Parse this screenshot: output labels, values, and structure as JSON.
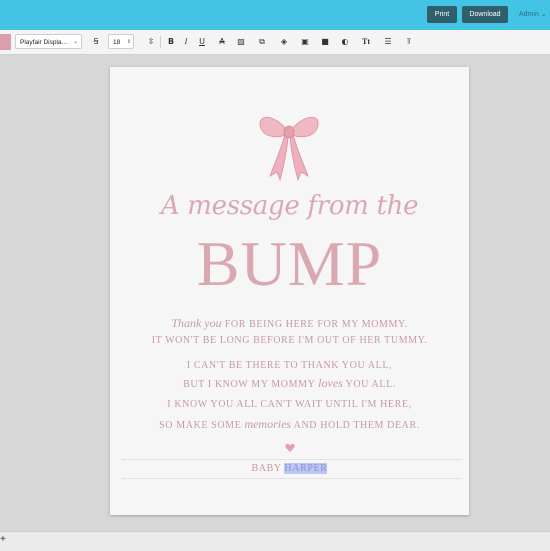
{
  "header": {
    "print_label": "Print",
    "download_label": "Download",
    "admin_label": "Admin"
  },
  "toolbar": {
    "font_family": "Playfair Displa…",
    "font_size": "18",
    "icons": [
      "font-clear-icon",
      "line-height-icon",
      "bold-icon",
      "italic-icon",
      "underline-icon",
      "strikethrough-icon",
      "image-icon",
      "copy-icon",
      "layers-icon",
      "lock-icon",
      "group-icon",
      "color-icon",
      "text-case-icon",
      "line-spacing-icon",
      "align-icon"
    ]
  },
  "card": {
    "title_script": "A message from the",
    "title_main": "BUMP",
    "line1_italic": "Thank you",
    "line1_rest": " FOR BEING HERE FOR MY MOMMY.",
    "line2": "IT WON'T BE LONG BEFORE I'M OUT OF HER TUMMY.",
    "line3": "I CAN'T BE THERE TO THANK YOU ALL,",
    "line4_a": "BUT I KNOW MY MOMMY ",
    "line4_italic": "loves",
    "line4_b": " YOU ALL.",
    "line5": "I KNOW YOU ALL CAN'T WAIT UNTIL I'M HERE,",
    "line6_a": "SO MAKE SOME ",
    "line6_italic": "memories",
    "line6_b": " AND HOLD THEM DEAR.",
    "name_prefix": "BABY ",
    "name_selected": "HARPER"
  },
  "bottom_bar": {
    "add_label": "+"
  },
  "colors": {
    "accent": "#43c4e4",
    "pink": "#d9a8b1",
    "bow": "#f0b8c2"
  }
}
